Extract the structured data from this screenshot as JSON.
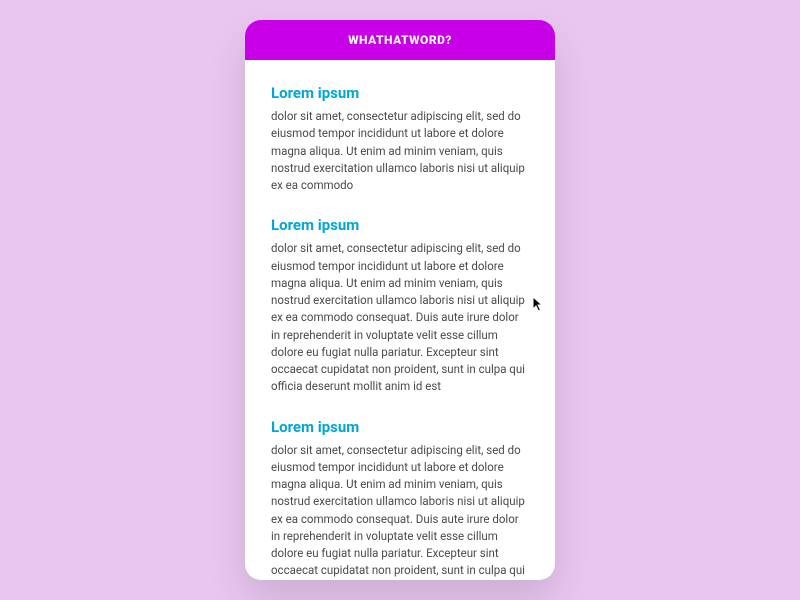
{
  "header": {
    "title": "WHATHATWORD?"
  },
  "sections": [
    {
      "title": "Lorem ipsum",
      "body": "dolor sit amet, consectetur adipiscing elit, sed do eiusmod tempor incididunt ut labore et dolore magna aliqua. Ut enim ad minim veniam, quis nostrud exercitation ullamco laboris nisi ut aliquip ex ea commodo"
    },
    {
      "title": "Lorem ipsum",
      "body": "dolor sit amet, consectetur adipiscing elit, sed do eiusmod tempor incididunt ut labore et dolore magna aliqua. Ut enim ad minim veniam, quis nostrud exercitation ullamco laboris nisi ut aliquip ex ea commodo consequat. Duis aute irure dolor in reprehenderit in voluptate velit esse cillum dolore eu fugiat nulla pariatur. Excepteur sint occaecat cupidatat non proident, sunt in culpa qui officia deserunt mollit anim id est"
    },
    {
      "title": "Lorem ipsum",
      "body": "dolor sit amet, consectetur adipiscing elit, sed do eiusmod tempor incididunt ut labore et dolore magna aliqua. Ut enim ad minim veniam, quis nostrud exercitation ullamco laboris nisi ut aliquip ex ea commodo consequat. Duis aute irure dolor in reprehenderit in voluptate velit esse cillum dolore eu fugiat nulla pariatur. Excepteur sint occaecat cupidatat non proident, sunt in culpa qui officia deserunt mollit anim id est"
    }
  ]
}
